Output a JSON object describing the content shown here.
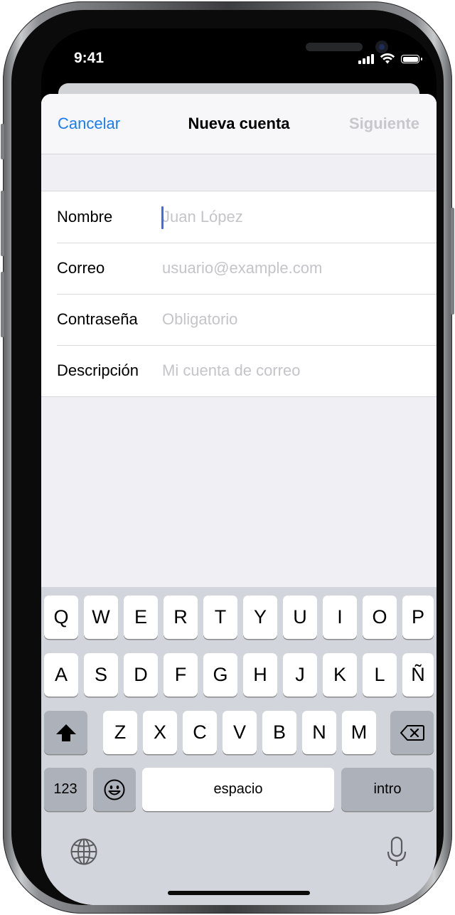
{
  "status_bar": {
    "time": "9:41"
  },
  "nav": {
    "cancel": "Cancelar",
    "title": "Nueva cuenta",
    "next": "Siguiente"
  },
  "form": {
    "fields": [
      {
        "label": "Nombre",
        "placeholder": "Juan López"
      },
      {
        "label": "Correo",
        "placeholder": "usuario@example.com"
      },
      {
        "label": "Contraseña",
        "placeholder": "Obligatorio"
      },
      {
        "label": "Descripción",
        "placeholder": "Mi cuenta de correo"
      }
    ]
  },
  "keyboard": {
    "row1": [
      "Q",
      "W",
      "E",
      "R",
      "T",
      "Y",
      "U",
      "I",
      "O",
      "P"
    ],
    "row2": [
      "A",
      "S",
      "D",
      "F",
      "G",
      "H",
      "J",
      "K",
      "L",
      "Ñ"
    ],
    "row3": [
      "Z",
      "X",
      "C",
      "V",
      "B",
      "N",
      "M"
    ],
    "numbers": "123",
    "space": "espacio",
    "return": "intro"
  },
  "icons": {
    "signal": "cellular-signal-icon",
    "wifi": "wifi-icon",
    "battery": "battery-icon",
    "shift": "shift-icon",
    "delete": "delete-icon",
    "emoji": "emoji-icon",
    "globe": "globe-icon",
    "mic": "microphone-icon"
  },
  "colors": {
    "accent": "#1a7cf3",
    "cursor": "#3d6bf0",
    "disabled": "#c7c7cc"
  }
}
